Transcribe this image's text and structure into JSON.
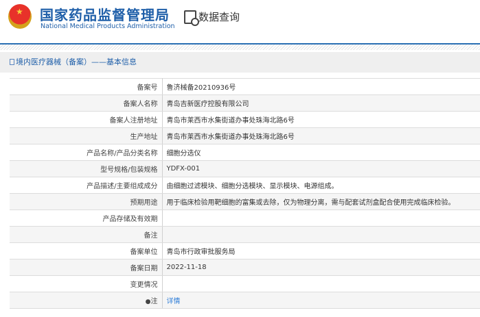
{
  "header": {
    "title_cn": "国家药品监督管理局",
    "title_en": "National Medical Products Administration",
    "query_label": "数据查询"
  },
  "section": {
    "title": "境内医疗器械（备案）——基本信息"
  },
  "rows": [
    {
      "label": "备案号",
      "value": "鲁济械备20210936号"
    },
    {
      "label": "备案人名称",
      "value": "青岛吉新医疗控股有限公司"
    },
    {
      "label": "备案人注册地址",
      "value": "青岛市莱西市水集街道办事处珠海北路6号"
    },
    {
      "label": "生产地址",
      "value": "青岛市莱西市水集街道办事处珠海北路6号"
    },
    {
      "label": "产品名称/产品分类名称",
      "value": "细胞分选仪"
    },
    {
      "label": "型号规格/包装规格",
      "value": "YDFX-001"
    },
    {
      "label": "产品描述/主要组成成分",
      "value": "由细胞过滤模块、细胞分选模块、显示模块、电源组成。"
    },
    {
      "label": "预期用途",
      "value": "用于临床检验用靶细胞的富集或去除，仅为物理分离，需与配套试剂盒配合使用完成临床检验。"
    },
    {
      "label": "产品存储及有效期",
      "value": ""
    },
    {
      "label": "备注",
      "value": ""
    },
    {
      "label": "备案单位",
      "value": "青岛市行政审批服务局"
    },
    {
      "label": "备案日期",
      "value": "2022-11-18"
    },
    {
      "label": "变更情况",
      "value": ""
    },
    {
      "label": "注",
      "value": "详情"
    }
  ]
}
